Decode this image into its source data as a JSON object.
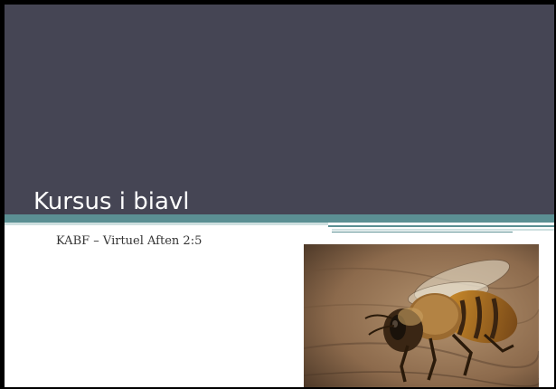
{
  "slide": {
    "title": "Kursus i biavl",
    "subtitle": "KABF – Virtuel Aften 2:5"
  },
  "image": {
    "subject": "honeybee-photo"
  },
  "colors": {
    "frame": "#000000",
    "title_band": "#454554",
    "accent_teal": "#5b8f93",
    "accent_light": "#cfe0e0",
    "background": "#ffffff"
  }
}
